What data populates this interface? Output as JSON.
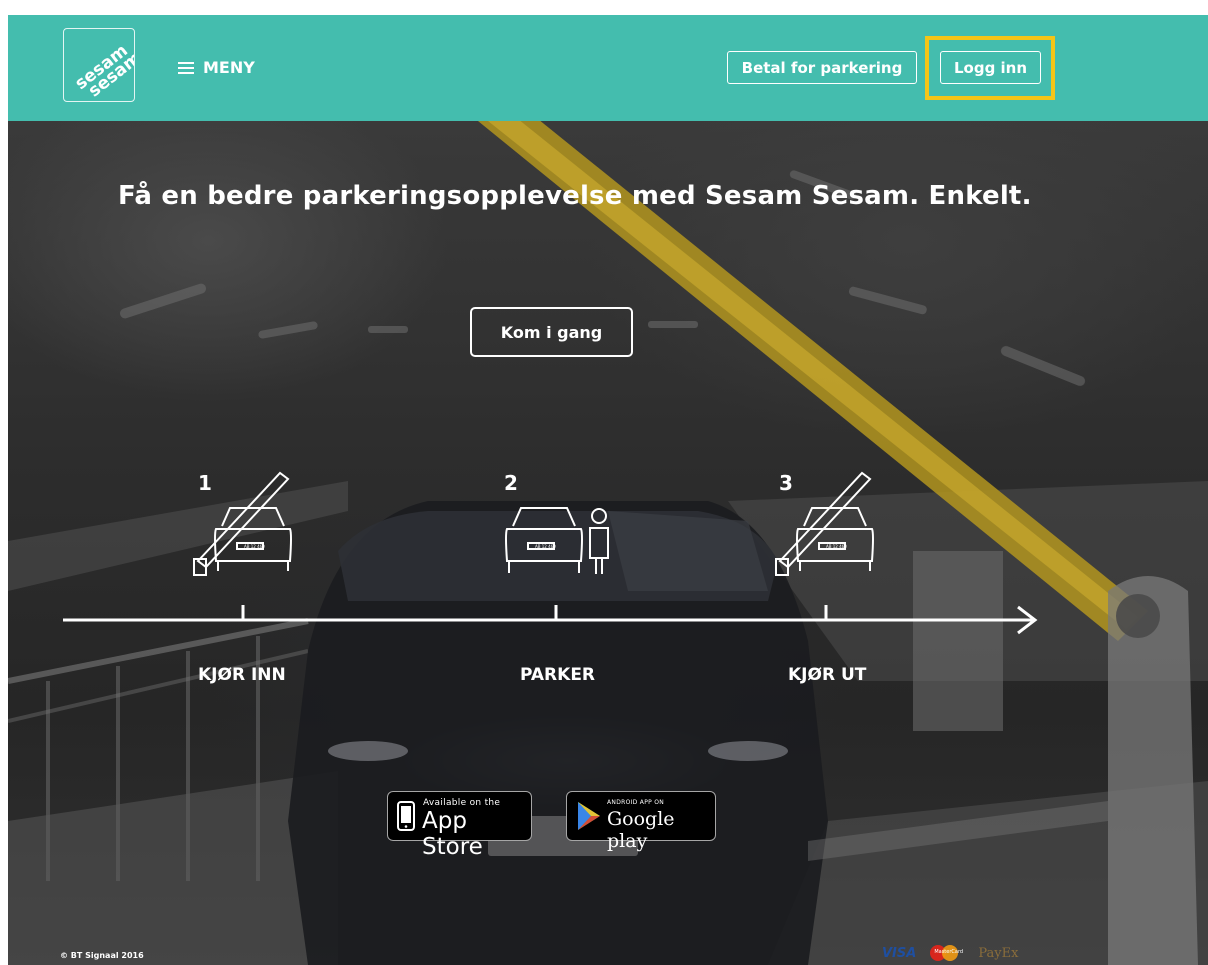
{
  "header": {
    "logo_text_1": "sesam",
    "logo_text_2": "sesam",
    "menu_label": "MENY",
    "pay_button": "Betal for parkering",
    "login_button": "Logg inn"
  },
  "hero": {
    "headline": "Få en bedre parkeringsopplevelse med Sesam Sesam. Enkelt.",
    "cta_button": "Kom i gang",
    "steps": [
      {
        "number": "1",
        "label": "KJØR INN"
      },
      {
        "number": "2",
        "label": "PARKER"
      },
      {
        "number": "3",
        "label": "KJØR UT"
      }
    ],
    "plate_text": "AB 12 460"
  },
  "stores": {
    "appstore_small": "Available on the",
    "appstore_big": "App Store",
    "gplay_small": "ANDROID APP ON",
    "gplay_big": "Google play"
  },
  "footer": {
    "copyright": "© BT Signaal 2016",
    "visa": "VISA",
    "mastercard": "MasterCard",
    "payex": "PayEx"
  },
  "colors": {
    "header_bg": "#44bdae",
    "highlight": "#f5c518",
    "barrier_yellow": "#c9a61a"
  }
}
